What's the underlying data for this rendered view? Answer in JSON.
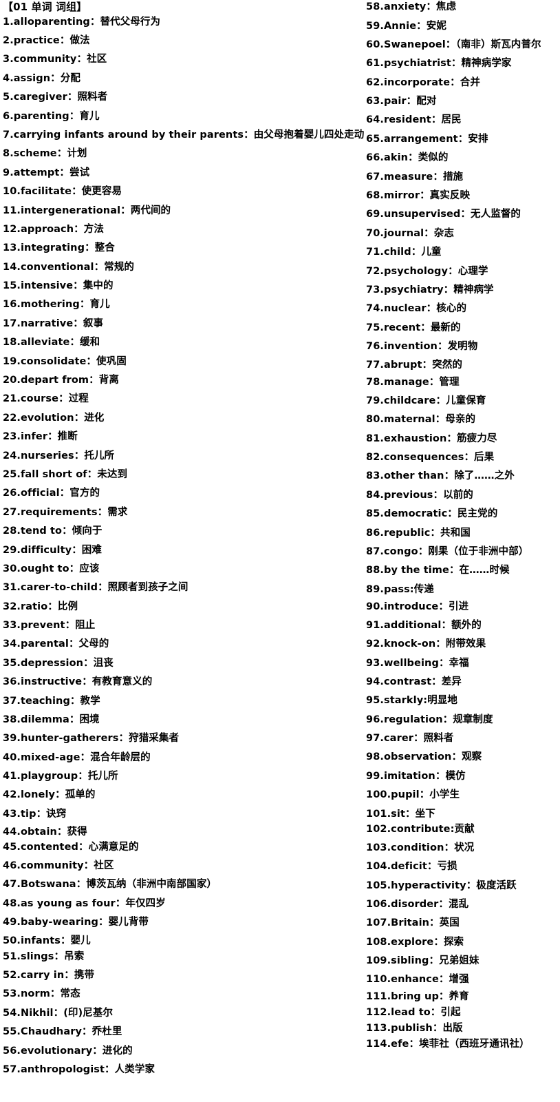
{
  "title": "【01 单词 词组】",
  "left_entries": [
    "1.alloparenting：替代父母行为",
    "2.practice：做法",
    "3.community：社区",
    "4.assign：分配",
    "5.caregiver：照料者",
    "6.parenting：育儿",
    "7.carrying infants around by their parents：由父母抱着婴儿四处走动",
    "8.scheme：计划",
    "9.attempt：尝试",
    "10.facilitate：使更容易",
    "11.intergenerational：两代间的",
    "12.approach：方法",
    "13.integrating：整合",
    "14.conventional：常规的",
    "15.intensive：集中的",
    "16.mothering：育儿",
    "17.narrative：叙事",
    "18.alleviate：缓和",
    "19.consolidate：使巩固",
    "20.depart from：背离",
    "21.course：过程",
    "22.evolution：进化",
    "23.infer：推断",
    "24.nurseries：托儿所",
    "25.fall short of：未达到",
    "26.official：官方的",
    "27.requirements：需求",
    "28.tend to：倾向于",
    "29.difficulty：困难",
    "30.ought to：应该",
    "31.carer-to-child：照顾者到孩子之间",
    "32.ratio：比例",
    "33.prevent：阻止",
    "34.parental：父母的",
    "35.depression：沮丧",
    "36.instructive：有教育意义的",
    "37.teaching：教学",
    "38.dilemma：困境",
    "39.hunter-gatherers：狩猎采集者",
    "40.mixed-age：混合年龄层的",
    "41.playgroup：托儿所",
    "42.lonely：孤单的",
    "43.tip：诀窍",
    "44.obtain：获得",
    "45.contented：心满意足的",
    "46.community：社区",
    "47.Botswana：博茨瓦纳（非洲中南部国家）",
    "48.as young as four：年仅四岁",
    "49.baby-wearing：婴儿背带",
    "50.infants：婴儿",
    "51.slings：吊索",
    "52.carry in：携带",
    "53.norm：常态",
    "54.Nikhil：(印)尼基尔",
    "55.Chaudhary：乔杜里",
    "56.evolutionary：进化的",
    "57.anthropologist：人类学家"
  ],
  "right_entries": [
    "58.anxiety：焦虑",
    "59.Annie：安妮",
    "60.Swanepoel：（南非）斯瓦内普尔",
    "61.psychiatrist：精神病学家",
    "62.incorporate：合并",
    "63.pair：配对",
    "64.resident：居民",
    "65.arrangement：安排",
    "66.akin：类似的",
    "67.measure：措施",
    "68.mirror：真实反映",
    "69.unsupervised：无人监督的",
    "70.journal：杂志",
    "71.child：儿童",
    "72.psychology：心理学",
    "73.psychiatry：精神病学",
    "74.nuclear：核心的",
    "75.recent：最新的",
    "76.invention：发明物",
    "77.abrupt：突然的",
    "78.manage：管理",
    "79.childcare：儿童保育",
    "80.maternal：母亲的",
    "81.exhaustion：筋疲力尽",
    "82.consequences：后果",
    "83.other than：除了……之外",
    "84.previous：以前的",
    "85.democratic：民主党的",
    "86.republic：共和国",
    "87.congo：刚果（位于非洲中部）",
    "88.by the time：在……时候",
    "89.pass:传递",
    "90.introduce：引进",
    "91.additional：额外的",
    "92.knock-on：附带效果",
    "93.wellbeing：幸福",
    "94.contrast：差异",
    "95.starkly:明显地",
    "96.regulation：规章制度",
    "97.carer：照料者",
    "98.observation：观察",
    "99.imitation：模仿",
    "100.pupil：小学生",
    "101.sit：坐下",
    "102.contribute:贡献",
    "103.condition：状况",
    "104.deficit：亏损",
    "105.hyperactivity：极度活跃",
    "106.disorder：混乱",
    "107.Britain：英国",
    "108.explore：探索",
    "109.sibling：兄弟姐妹",
    "110.enhance：增强",
    "111.bring up：养育",
    "112.lead to：引起",
    "113.publish：出版",
    "114.efe：埃菲社（西班牙通讯社）"
  ]
}
